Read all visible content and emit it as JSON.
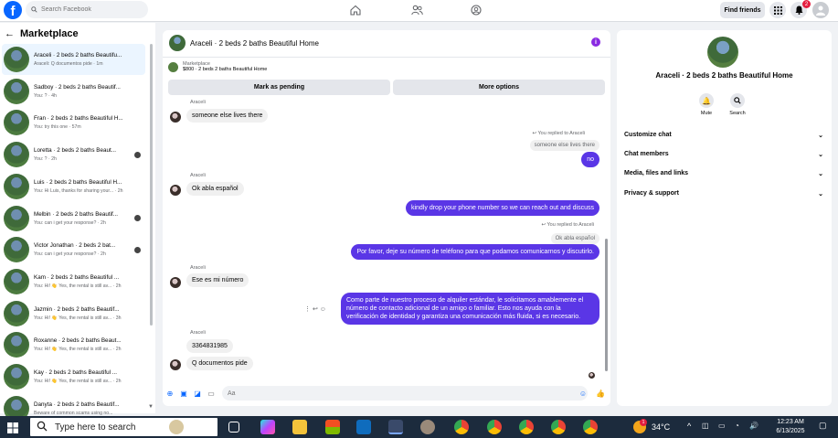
{
  "topbar": {
    "search_placeholder": "Search Facebook",
    "find_friends": "Find friends",
    "notification_count": "2"
  },
  "sidebar": {
    "title": "Marketplace",
    "conversations": [
      {
        "name": "Araceli · 2 beds 2 baths Beautifu...",
        "preview": "Araceli: Q documentos pide · 1m",
        "active": true
      },
      {
        "name": "Sadboy · 2 beds 2 baths Beautif...",
        "preview": "You: ? · 4h"
      },
      {
        "name": "Fran · 2 beds 2 baths Beautiful H...",
        "preview": "You: try this one · 57m"
      },
      {
        "name": "Loretta · 2 beds 2 baths Beaut...",
        "preview": "You: ? · 2h"
      },
      {
        "name": "Luis · 2 beds 2 baths Beautiful H...",
        "preview": "You: Hi Luis, thanks for sharing your... · 2h"
      },
      {
        "name": "Melbin · 2 beds 2 baths Beautif...",
        "preview": "You: can i get your response? · 2h"
      },
      {
        "name": "Victor Jonathan · 2 beds 2 bat...",
        "preview": "You: can i get your response? · 2h"
      },
      {
        "name": "Kam · 2 beds 2 baths Beautiful ...",
        "preview": "You: Hi! 👋 Yes, the rental is still av... · 2h"
      },
      {
        "name": "Jazmin · 2 beds 2 baths Beautif...",
        "preview": "You: Hi! 👋 Yes, the rental is still av... · 3h"
      },
      {
        "name": "Roxanne · 2 beds 2 baths Beaut...",
        "preview": "You: Hi! 👋 Yes, the rental is still av... · 2h"
      },
      {
        "name": "Kay · 2 beds 2 baths Beautiful ...",
        "preview": "You: Hi! 👋 Yes, the rental is still av... · 2h"
      },
      {
        "name": "Danyta · 2 beds 2 baths Beautif...",
        "preview": "Beware of common scams using no..."
      }
    ]
  },
  "chat": {
    "title": "Araceli · 2 beds 2 baths Beautiful Home",
    "marketplace_label": "Marketplace",
    "listing": "$800 · 2 beds 2 baths Beautiful Home",
    "mark_pending": "Mark as pending",
    "more_options": "More options",
    "sender_name": "Araceli",
    "messages": {
      "m1": "someone else lives there",
      "replied1": "You replied to Araceli",
      "quote1": "someone else lives there",
      "m2": "no",
      "m3": "Ok abla español",
      "m4": "kindly drop your phone number so we can reach out and discuss",
      "replied2": "You replied to Araceli",
      "quote2": "Ok abla español",
      "m5": "Por favor, deje su número de teléfono para que podamos comunicarnos y discutirlo.",
      "m6": "Ese es mi número",
      "m7": "Como parte de nuestro proceso de alquiler estándar, le solicitamos amablemente el número de contacto adicional de un amigo o familiar. Esto nos ayuda con la verificación de identidad y garantiza una comunicación más fluida, si es necesario.",
      "m8": "3364831985",
      "m9": "Q documentos  pide"
    },
    "composer_placeholder": "Aa"
  },
  "details": {
    "title": "Araceli · 2 beds 2 baths Beautiful Home",
    "mute": "Mute",
    "search": "Search",
    "sections": [
      "Customize chat",
      "Chat members",
      "Media, files and links",
      "Privacy & support"
    ]
  },
  "taskbar": {
    "search_placeholder": "Type here to search",
    "temperature": "34°C",
    "weather_badge": "1",
    "time": "12:23 AM",
    "date": "6/13/2025"
  },
  "colors": {
    "brand": "#0866ff",
    "outgoing_bubble": "#5a36e6",
    "taskbar": "#1c2b3d"
  }
}
